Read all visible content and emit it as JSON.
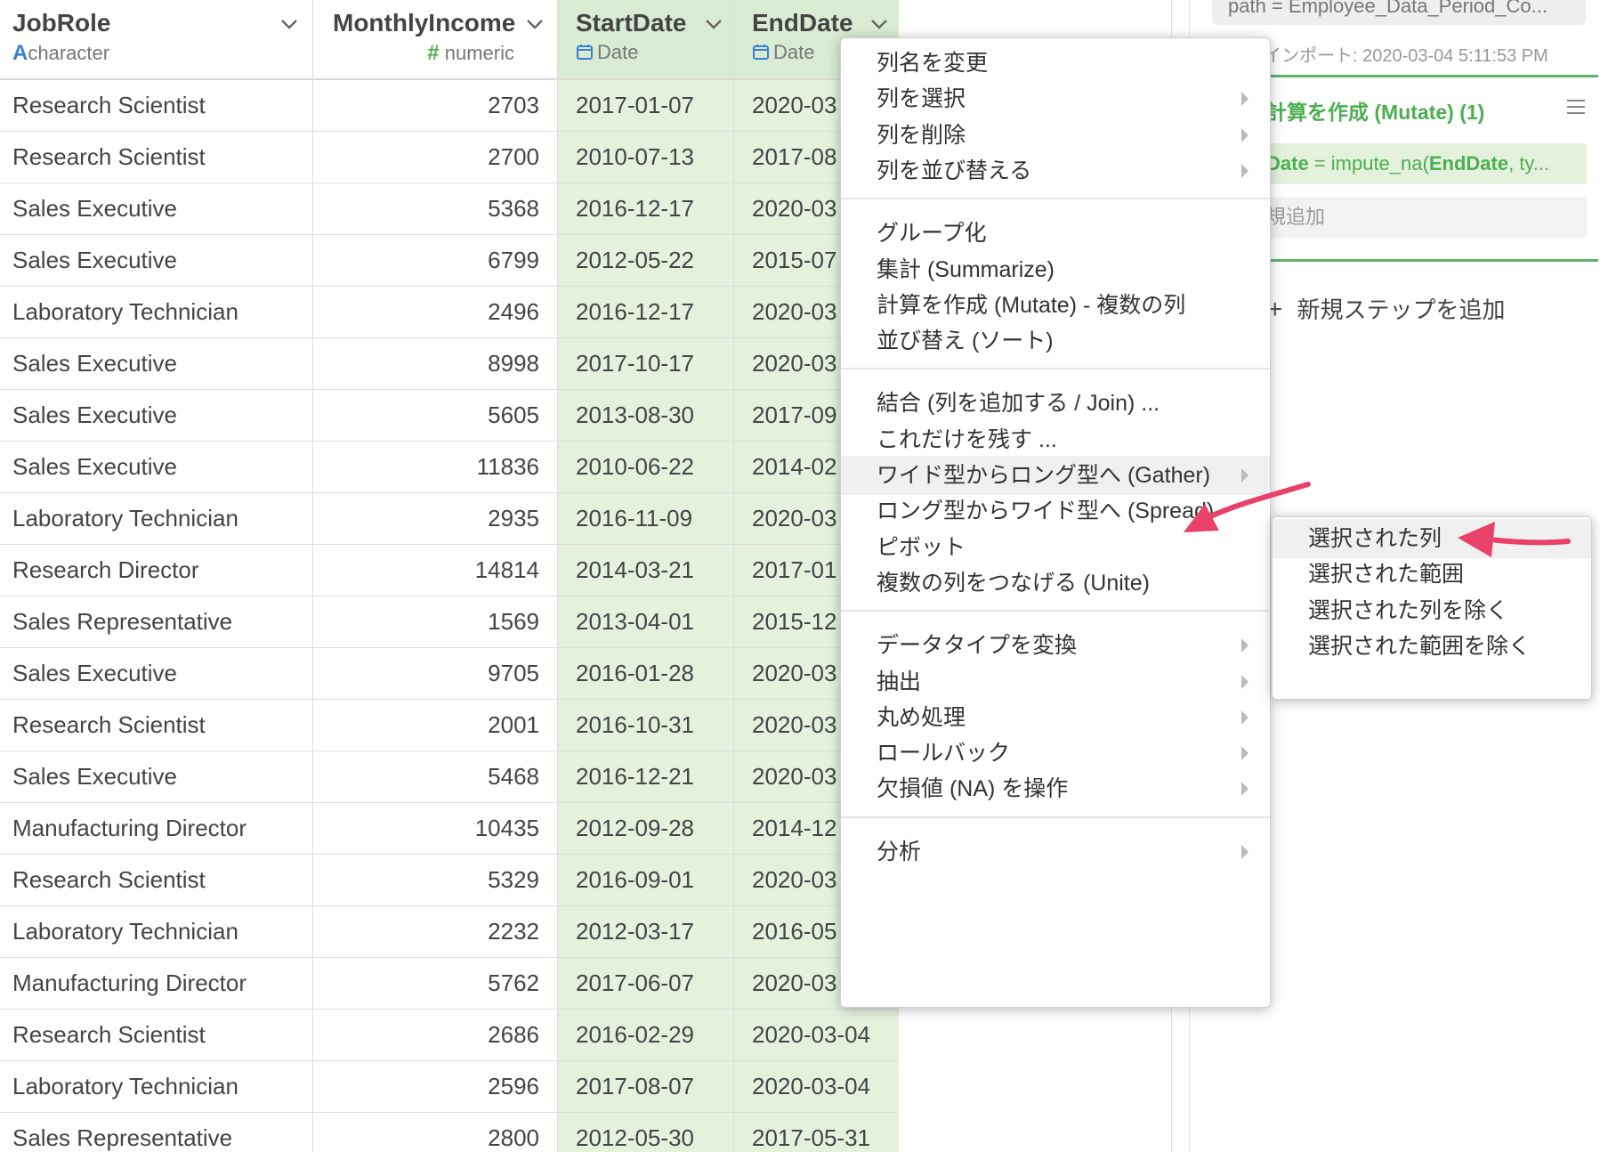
{
  "columns": [
    {
      "name": "JobRole",
      "type_label": "character",
      "type_glyph": "A"
    },
    {
      "name": "MonthlyIncome",
      "type_label": "numeric",
      "type_glyph": "#"
    },
    {
      "name": "StartDate",
      "type_label": "Date"
    },
    {
      "name": "EndDate",
      "type_label": "Date"
    }
  ],
  "rows": [
    [
      "Research Scientist",
      "2703",
      "2017-01-07",
      "2020-03"
    ],
    [
      "Research Scientist",
      "2700",
      "2010-07-13",
      "2017-08"
    ],
    [
      "Sales Executive",
      "5368",
      "2016-12-17",
      "2020-03"
    ],
    [
      "Sales Executive",
      "6799",
      "2012-05-22",
      "2015-07"
    ],
    [
      "Laboratory Technician",
      "2496",
      "2016-12-17",
      "2020-03"
    ],
    [
      "Sales Executive",
      "8998",
      "2017-10-17",
      "2020-03"
    ],
    [
      "Sales Executive",
      "5605",
      "2013-08-30",
      "2017-09"
    ],
    [
      "Sales Executive",
      "11836",
      "2010-06-22",
      "2014-02"
    ],
    [
      "Laboratory Technician",
      "2935",
      "2016-11-09",
      "2020-03"
    ],
    [
      "Research Director",
      "14814",
      "2014-03-21",
      "2017-01"
    ],
    [
      "Sales Representative",
      "1569",
      "2013-04-01",
      "2015-12"
    ],
    [
      "Sales Executive",
      "9705",
      "2016-01-28",
      "2020-03"
    ],
    [
      "Research Scientist",
      "2001",
      "2016-10-31",
      "2020-03"
    ],
    [
      "Sales Executive",
      "5468",
      "2016-12-21",
      "2020-03"
    ],
    [
      "Manufacturing Director",
      "10435",
      "2012-09-28",
      "2014-12"
    ],
    [
      "Research Scientist",
      "5329",
      "2016-09-01",
      "2020-03"
    ],
    [
      "Laboratory Technician",
      "2232",
      "2012-03-17",
      "2016-05"
    ],
    [
      "Manufacturing Director",
      "5762",
      "2017-06-07",
      "2020-03"
    ],
    [
      "Research Scientist",
      "2686",
      "2016-02-29",
      "2020-03-04"
    ],
    [
      "Laboratory Technician",
      "2596",
      "2017-08-07",
      "2020-03-04"
    ],
    [
      "Sales Representative",
      "2800",
      "2012-05-30",
      "2017-05-31"
    ]
  ],
  "right_panel": {
    "path_step": "path = Employee_Data_Period_Co...",
    "import_text": "インポート: 2020-03-04 5:11:53 PM",
    "mutate_title": "計算を作成 (Mutate) (1)",
    "mutate_expr_var": "Date",
    "mutate_expr_rest": " = impute_na(",
    "mutate_expr_arg": "EndDate",
    "mutate_expr_tail": ", ty...",
    "mutate_add": "規追加",
    "add_step_label": "新規ステップを追加"
  },
  "context_menu": {
    "groups": [
      [
        {
          "label": "列名を変更",
          "has_submenu": false
        },
        {
          "label": "列を選択",
          "has_submenu": true
        },
        {
          "label": "列を削除",
          "has_submenu": true
        },
        {
          "label": "列を並び替える",
          "has_submenu": true
        }
      ],
      [
        {
          "label": "グループ化",
          "has_submenu": false
        },
        {
          "label": "集計 (Summarize)",
          "has_submenu": false
        },
        {
          "label": "計算を作成 (Mutate) - 複数の列",
          "has_submenu": false
        },
        {
          "label": "並び替え (ソート)",
          "has_submenu": false
        }
      ],
      [
        {
          "label": "結合 (列を追加する / Join) ...",
          "has_submenu": false
        },
        {
          "label": "これだけを残す ...",
          "has_submenu": false
        },
        {
          "label": "ワイド型からロング型へ (Gather)",
          "has_submenu": true,
          "highlighted": true
        },
        {
          "label": "ロング型からワイド型へ (Spread)",
          "has_submenu": false
        },
        {
          "label": "ピボット",
          "has_submenu": false
        },
        {
          "label": "複数の列をつなげる (Unite)",
          "has_submenu": false
        }
      ],
      [
        {
          "label": "データタイプを変換",
          "has_submenu": true
        },
        {
          "label": "抽出",
          "has_submenu": true
        },
        {
          "label": "丸め処理",
          "has_submenu": true
        },
        {
          "label": "ロールバック",
          "has_submenu": true
        },
        {
          "label": "欠損値 (NA) を操作",
          "has_submenu": true
        }
      ],
      [
        {
          "label": "分析",
          "has_submenu": true
        }
      ]
    ]
  },
  "submenu": {
    "items": [
      {
        "label": "選択された列",
        "highlighted": true
      },
      {
        "label": "選択された範囲"
      },
      {
        "label": "選択された列を除く"
      },
      {
        "label": "選択された範囲を除く"
      }
    ]
  },
  "colors": {
    "accent_green": "#4caf50",
    "selected_column_bg": "#e3f1dd",
    "annotation_arrow": "#e8416a",
    "type_char_blue": "#3a7fd6"
  }
}
